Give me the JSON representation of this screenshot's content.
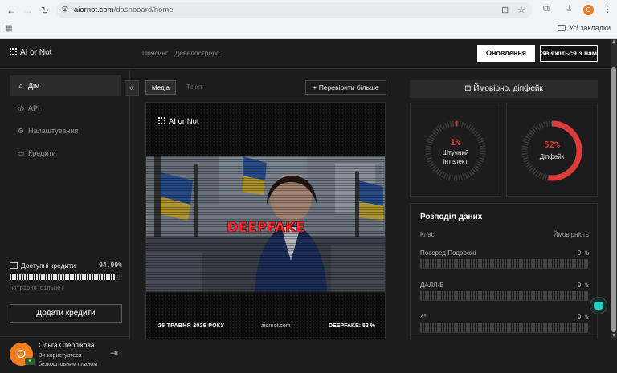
{
  "browser": {
    "url_host": "aiornot.com",
    "url_path": "/dashboard/home",
    "profile_letter": "О",
    "bookmarks_all": "Усі закладки"
  },
  "header": {
    "logo": "AI or Not",
    "links": [
      "Прясинг",
      "Девелострерс"
    ],
    "update_button": "Оновлення",
    "contact_button": "Зв'яжіться з нами"
  },
  "sidebar": {
    "items": [
      {
        "label": "Дім",
        "icon": "home-icon"
      },
      {
        "label": "API",
        "icon": "code-icon"
      },
      {
        "label": "Налаштування",
        "icon": "gear-icon"
      },
      {
        "label": "Кредити",
        "icon": "card-icon"
      }
    ],
    "credits_label": "Доступні кредити",
    "credits_percent": "94,99%",
    "credits_fraction": 0.9499,
    "need_more": "Потрібно більше?",
    "add_credits": "Додати кредити",
    "user_name": "Ольга Стерлікова",
    "user_sub1": "Ви користуєтеся",
    "user_sub2": "безкоштовним планом",
    "avatar_letter": "О"
  },
  "center": {
    "tab_media": "Медіа",
    "tab_text": "Текст",
    "check_more": "+ Перевірити більше",
    "card_logo": "AI or Not",
    "overlay_label": "DEEPFAKE",
    "footer_date": "26 ТРАВНЯ 2026 РОКУ",
    "footer_site": "aiornot.com",
    "footer_verdict": "DEEPFAKE: 52 %"
  },
  "right": {
    "verdict": "Ймовірно, діпфейк",
    "gauges": [
      {
        "value": "1%",
        "fraction": 0.01,
        "label1": "Штучний",
        "label2": "інтелект"
      },
      {
        "value": "52%",
        "fraction": 0.52,
        "label1": "Діпфейк",
        "label2": ""
      }
    ],
    "dist_title": "Розподіл даних",
    "dist_col1": "Клас",
    "dist_col2": "Ймовірність",
    "dist_rows": [
      {
        "name": "Посеред Подорожі",
        "pct": "0 %"
      },
      {
        "name": "ДАЛЛ·Е",
        "pct": "0 %"
      },
      {
        "name": "4°",
        "pct": "0 %"
      }
    ]
  },
  "colors": {
    "accent_red": "#e03b3b",
    "avatar_orange": "#f07e1f",
    "chat_teal": "#19d3c5"
  }
}
